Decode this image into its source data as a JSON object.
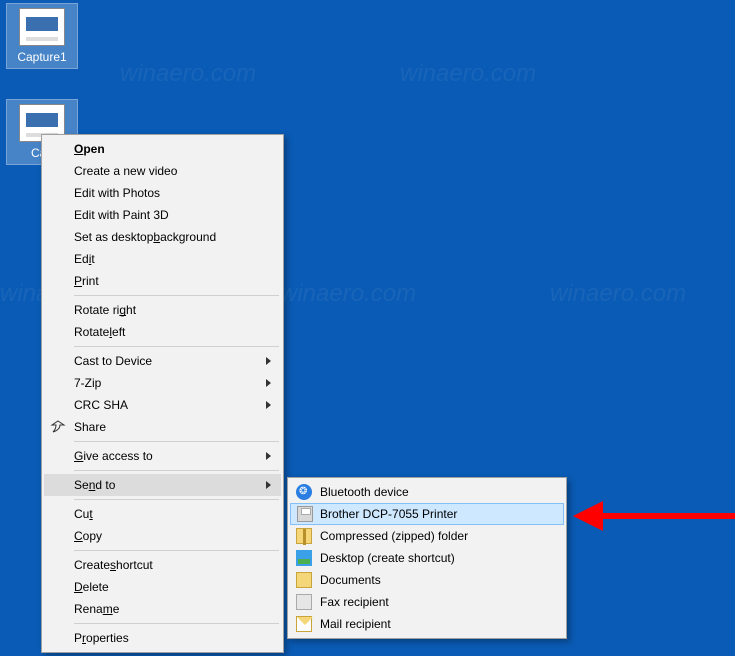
{
  "watermark": "winaero.com",
  "desktop": {
    "icons": [
      {
        "label": "Capture1"
      },
      {
        "label": "Cap"
      }
    ]
  },
  "context_menu": {
    "items": [
      {
        "pre": "",
        "u": "O",
        "post": "pen"
      },
      {
        "label": "Create a new video"
      },
      {
        "label": "Edit with Photos"
      },
      {
        "label": "Edit with Paint 3D"
      },
      {
        "pre": "Set as desktop ",
        "u": "b",
        "post": "ackground"
      },
      {
        "pre": "Ed",
        "u": "i",
        "post": "t"
      },
      {
        "pre": "",
        "u": "P",
        "post": "rint"
      },
      {
        "pre": "Rotate ri",
        "u": "g",
        "post": "ht"
      },
      {
        "pre": "Rotate ",
        "u": "l",
        "post": "eft"
      },
      {
        "label": "Cast to Device",
        "arrow": true
      },
      {
        "label": "7-Zip",
        "arrow": true
      },
      {
        "label": "CRC SHA",
        "arrow": true
      },
      {
        "label": "Share",
        "icon": "share"
      },
      {
        "pre": "",
        "u": "G",
        "post": "ive access to",
        "arrow": true
      },
      {
        "pre": "Se",
        "u": "n",
        "post": "d to",
        "arrow": true,
        "highlight": true
      },
      {
        "pre": "Cu",
        "u": "t",
        "post": ""
      },
      {
        "pre": "",
        "u": "C",
        "post": "opy"
      },
      {
        "pre": "Create ",
        "u": "s",
        "post": "hortcut"
      },
      {
        "pre": "",
        "u": "D",
        "post": "elete"
      },
      {
        "pre": "Rena",
        "u": "m",
        "post": "e"
      },
      {
        "pre": "P",
        "u": "r",
        "post": "operties"
      }
    ]
  },
  "submenu": {
    "items": [
      {
        "label": "Bluetooth device",
        "icon": "bt"
      },
      {
        "label": "Brother DCP-7055 Printer",
        "icon": "print",
        "highlight": true
      },
      {
        "label": "Compressed (zipped) folder",
        "icon": "zip"
      },
      {
        "label": "Desktop (create shortcut)",
        "icon": "desk"
      },
      {
        "label": "Documents",
        "icon": "doc"
      },
      {
        "label": "Fax recipient",
        "icon": "fax"
      },
      {
        "label": "Mail recipient",
        "icon": "mail"
      }
    ]
  }
}
